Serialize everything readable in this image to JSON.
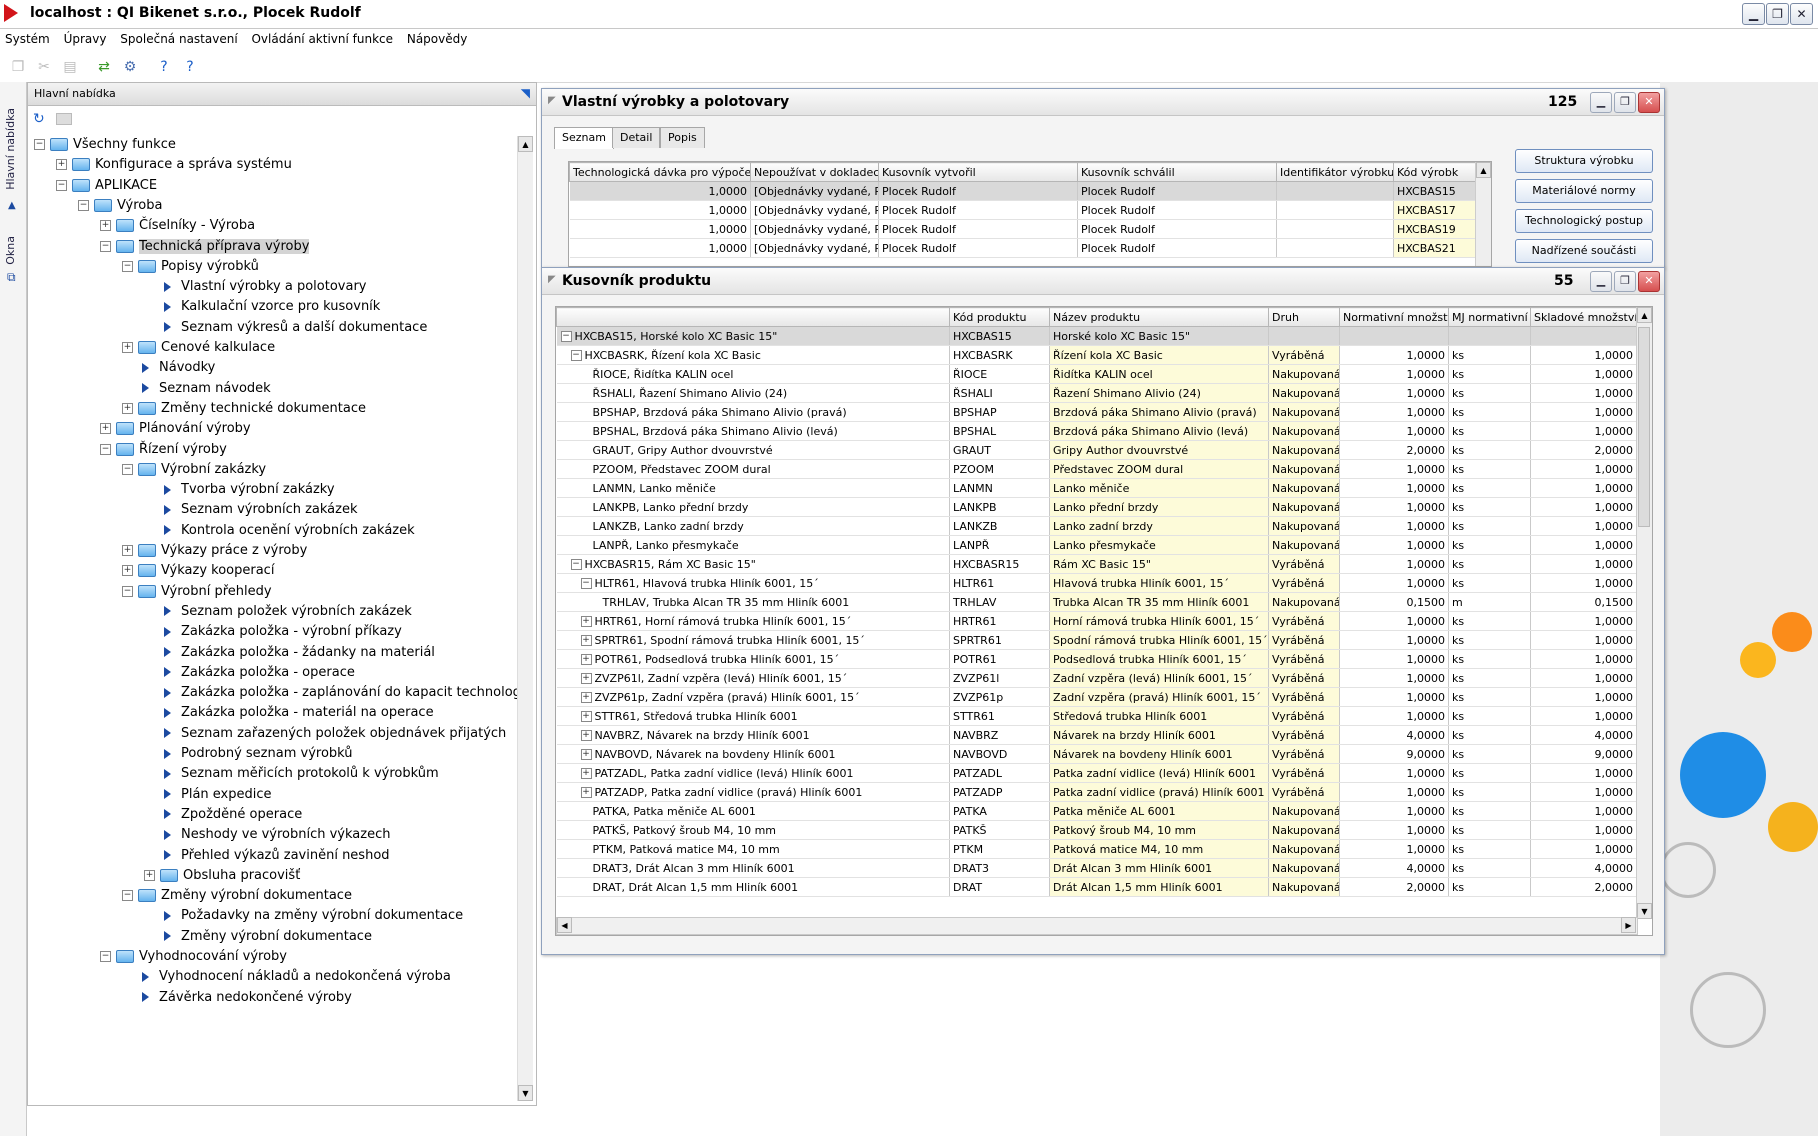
{
  "window": {
    "title": "localhost : QI  Bikenet s.r.o., Plocek Rudolf",
    "min": "▁",
    "max": "❐",
    "close": "✕"
  },
  "menu": [
    "Systém",
    "Úpravy",
    "Společná nastavení",
    "Ovládání aktivní funkce",
    "Nápovědy"
  ],
  "left_tabs": {
    "main": "Hlavní nabídka",
    "windows": "Okna"
  },
  "nav": {
    "header": "Hlavní nabídka",
    "tree": [
      {
        "d": 0,
        "t": "f",
        "e": "-",
        "label": "Všechny funkce"
      },
      {
        "d": 1,
        "t": "f",
        "e": "+",
        "label": "Konfigurace a správa systému"
      },
      {
        "d": 1,
        "t": "f",
        "e": "-",
        "label": "APLIKACE"
      },
      {
        "d": 2,
        "t": "f",
        "e": "-",
        "label": "Výroba"
      },
      {
        "d": 3,
        "t": "f",
        "e": "+",
        "label": "Číselníky - Výroba"
      },
      {
        "d": 3,
        "t": "f",
        "e": "-",
        "label": "Technická příprava výroby",
        "sel": true
      },
      {
        "d": 4,
        "t": "f",
        "e": "-",
        "label": "Popisy výrobků"
      },
      {
        "d": 5,
        "t": "l",
        "label": "Vlastní výrobky a polotovary"
      },
      {
        "d": 5,
        "t": "l",
        "label": "Kalkulační vzorce pro kusovník"
      },
      {
        "d": 5,
        "t": "l",
        "label": "Seznam výkresů a další dokumentace"
      },
      {
        "d": 4,
        "t": "f",
        "e": "+",
        "label": "Cenové kalkulace"
      },
      {
        "d": 4,
        "t": "l",
        "label": "Návodky"
      },
      {
        "d": 4,
        "t": "l",
        "label": "Seznam návodek"
      },
      {
        "d": 4,
        "t": "f",
        "e": "+",
        "label": "Změny technické dokumentace"
      },
      {
        "d": 3,
        "t": "f",
        "e": "+",
        "label": "Plánování výroby"
      },
      {
        "d": 3,
        "t": "f",
        "e": "-",
        "label": "Řízení výroby"
      },
      {
        "d": 4,
        "t": "f",
        "e": "-",
        "label": "Výrobní zakázky"
      },
      {
        "d": 5,
        "t": "l",
        "label": "Tvorba výrobní zakázky"
      },
      {
        "d": 5,
        "t": "l",
        "label": "Seznam výrobních zakázek"
      },
      {
        "d": 5,
        "t": "l",
        "label": "Kontrola ocenění výrobních zakázek"
      },
      {
        "d": 4,
        "t": "f",
        "e": "+",
        "label": "Výkazy práce z výroby"
      },
      {
        "d": 4,
        "t": "f",
        "e": "+",
        "label": "Výkazy kooperací"
      },
      {
        "d": 4,
        "t": "f",
        "e": "-",
        "label": "Výrobní přehledy"
      },
      {
        "d": 5,
        "t": "l",
        "label": "Seznam položek výrobních zakázek"
      },
      {
        "d": 5,
        "t": "l",
        "label": "Zakázka položka - výrobní příkazy"
      },
      {
        "d": 5,
        "t": "l",
        "label": "Zakázka položka - žádanky na materiál"
      },
      {
        "d": 5,
        "t": "l",
        "label": "Zakázka položka - operace"
      },
      {
        "d": 5,
        "t": "l",
        "label": "Zakázka položka - zaplánování do kapacit technologií"
      },
      {
        "d": 5,
        "t": "l",
        "label": "Zakázka položka - materiál na operace"
      },
      {
        "d": 5,
        "t": "l",
        "label": "Seznam zařazených položek objednávek přijatých"
      },
      {
        "d": 5,
        "t": "l",
        "label": "Podrobný seznam výrobků"
      },
      {
        "d": 5,
        "t": "l",
        "label": "Seznam měřicích protokolů k výrobkům"
      },
      {
        "d": 5,
        "t": "l",
        "label": "Plán expedice"
      },
      {
        "d": 5,
        "t": "l",
        "label": "Zpožděné operace"
      },
      {
        "d": 5,
        "t": "l",
        "label": "Neshody ve výrobních výkazech"
      },
      {
        "d": 5,
        "t": "l",
        "label": "Přehled výkazů zavinění neshod"
      },
      {
        "d": 5,
        "t": "f",
        "e": "+",
        "label": "Obsluha pracovišť"
      },
      {
        "d": 4,
        "t": "f",
        "e": "-",
        "label": "Změny výrobní dokumentace"
      },
      {
        "d": 5,
        "t": "l",
        "label": "Požadavky na změny výrobní dokumentace"
      },
      {
        "d": 5,
        "t": "l",
        "label": "Změny výrobní dokumentace"
      },
      {
        "d": 3,
        "t": "f",
        "e": "-",
        "label": "Vyhodnocování výroby"
      },
      {
        "d": 4,
        "t": "l",
        "label": "Vyhodnocení nákladů a nedokončená výroba"
      },
      {
        "d": 4,
        "t": "l",
        "label": "Závěrka nedokončené výroby"
      }
    ]
  },
  "win1": {
    "title": "Vlastní výrobky a polotovary",
    "count": "125",
    "tabs": [
      "Seznam",
      "Detail",
      "Popis"
    ],
    "columns": [
      "Technologická dávka pro výpočet",
      "Nepoužívat v dokladech",
      "Kusovník vytvořil",
      "Kusovník schválil",
      "Identifikátor výrobku",
      "Kód výrobk"
    ],
    "rows": [
      [
        "1,0000",
        "[Objednávky vydané, Př",
        "Plocek Rudolf",
        "Plocek Rudolf",
        "",
        "HXCBAS15"
      ],
      [
        "1,0000",
        "[Objednávky vydané, Př",
        "Plocek Rudolf",
        "Plocek Rudolf",
        "",
        "HXCBAS17"
      ],
      [
        "1,0000",
        "[Objednávky vydané, Př",
        "Plocek Rudolf",
        "Plocek Rudolf",
        "",
        "HXCBAS19"
      ],
      [
        "1,0000",
        "[Objednávky vydané, Př",
        "Plocek Rudolf",
        "Plocek Rudolf",
        "",
        "HXCBAS21"
      ]
    ],
    "buttons": [
      "Struktura výrobku",
      "Materiálové normy",
      "Technologický postup",
      "Nadřízené součásti"
    ]
  },
  "win2": {
    "title": "Kusovník produktu",
    "count": "55",
    "columns": [
      "",
      "Kód produktu",
      "Název produktu",
      "Druh",
      "Normativní množství",
      "MJ normativní",
      "Skladové množství"
    ],
    "rows": [
      {
        "i": 0,
        "e": "-",
        "t": "HXCBAS15, Horské kolo XC Basic 15\"",
        "k": "HXCBAS15",
        "n": "Horské kolo XC Basic 15\"",
        "d": "",
        "q": "",
        "m": "",
        "s": ""
      },
      {
        "i": 1,
        "e": "-",
        "t": "HXCBASRK, Řízení kola XC Basic",
        "k": "HXCBASRK",
        "n": "Řízení kola XC Basic",
        "d": "Vyráběná",
        "q": "1,0000",
        "m": "ks",
        "s": "1,0000"
      },
      {
        "i": 2,
        "e": "",
        "t": "ŘIOCE, Řidítka KALIN ocel",
        "k": "ŘIOCE",
        "n": "Řidítka KALIN ocel",
        "d": "Nakupovaná",
        "q": "1,0000",
        "m": "ks",
        "s": "1,0000"
      },
      {
        "i": 2,
        "e": "",
        "t": "ŘSHALI, Řazení Shimano Alivio (24)",
        "k": "ŘSHALI",
        "n": "Řazení Shimano Alivio (24)",
        "d": "Nakupovaná",
        "q": "1,0000",
        "m": "ks",
        "s": "1,0000"
      },
      {
        "i": 2,
        "e": "",
        "t": "BPSHAP, Brzdová páka Shimano Alivio (pravá)",
        "k": "BPSHAP",
        "n": "Brzdová páka Shimano Alivio (pravá)",
        "d": "Nakupovaná",
        "q": "1,0000",
        "m": "ks",
        "s": "1,0000"
      },
      {
        "i": 2,
        "e": "",
        "t": "BPSHAL, Brzdová páka Shimano Alivio (levá)",
        "k": "BPSHAL",
        "n": "Brzdová páka Shimano Alivio (levá)",
        "d": "Nakupovaná",
        "q": "1,0000",
        "m": "ks",
        "s": "1,0000"
      },
      {
        "i": 2,
        "e": "",
        "t": "GRAUT, Gripy Author dvouvrstvé",
        "k": "GRAUT",
        "n": "Gripy Author dvouvrstvé",
        "d": "Nakupovaná",
        "q": "2,0000",
        "m": "ks",
        "s": "2,0000"
      },
      {
        "i": 2,
        "e": "",
        "t": "PZOOM, Představec ZOOM dural",
        "k": "PZOOM",
        "n": "Představec ZOOM dural",
        "d": "Nakupovaná",
        "q": "1,0000",
        "m": "ks",
        "s": "1,0000"
      },
      {
        "i": 2,
        "e": "",
        "t": "LANMN, Lanko měniče",
        "k": "LANMN",
        "n": "Lanko měniče",
        "d": "Nakupovaná",
        "q": "1,0000",
        "m": "ks",
        "s": "1,0000"
      },
      {
        "i": 2,
        "e": "",
        "t": "LANKPB, Lanko přední brzdy",
        "k": "LANKPB",
        "n": "Lanko přední brzdy",
        "d": "Nakupovaná",
        "q": "1,0000",
        "m": "ks",
        "s": "1,0000"
      },
      {
        "i": 2,
        "e": "",
        "t": "LANKZB, Lanko zadní brzdy",
        "k": "LANKZB",
        "n": "Lanko zadní brzdy",
        "d": "Nakupovaná",
        "q": "1,0000",
        "m": "ks",
        "s": "1,0000"
      },
      {
        "i": 2,
        "e": "",
        "t": "LANPŘ, Lanko přesmykače",
        "k": "LANPŘ",
        "n": "Lanko přesmykače",
        "d": "Nakupovaná",
        "q": "1,0000",
        "m": "ks",
        "s": "1,0000"
      },
      {
        "i": 1,
        "e": "-",
        "t": "HXCBASR15, Rám XC Basic 15\"",
        "k": "HXCBASR15",
        "n": "Rám XC Basic 15\"",
        "d": "Vyráběná",
        "q": "1,0000",
        "m": "ks",
        "s": "1,0000"
      },
      {
        "i": 2,
        "e": "-",
        "t": "HLTR61, Hlavová trubka Hliník 6001, 15´",
        "k": "HLTR61",
        "n": "Hlavová trubka Hliník 6001, 15´",
        "d": "Vyráběná",
        "q": "1,0000",
        "m": "ks",
        "s": "1,0000"
      },
      {
        "i": 3,
        "e": "",
        "t": "TRHLAV, Trubka Alcan TR 35 mm Hliník 6001",
        "k": "TRHLAV",
        "n": "Trubka Alcan TR 35 mm Hliník 6001",
        "d": "Nakupovaná",
        "q": "0,1500",
        "m": "m",
        "s": "0,1500"
      },
      {
        "i": 2,
        "e": "+",
        "t": "HRTR61, Horní rámová trubka Hliník 6001, 15´",
        "k": "HRTR61",
        "n": "Horní rámová trubka Hliník 6001, 15´",
        "d": "Vyráběná",
        "q": "1,0000",
        "m": "ks",
        "s": "1,0000"
      },
      {
        "i": 2,
        "e": "+",
        "t": "SPRTR61, Spodní rámová trubka Hliník 6001, 15´",
        "k": "SPRTR61",
        "n": "Spodní rámová trubka Hliník 6001, 15´",
        "d": "Vyráběná",
        "q": "1,0000",
        "m": "ks",
        "s": "1,0000"
      },
      {
        "i": 2,
        "e": "+",
        "t": "POTR61, Podsedlová trubka Hliník 6001, 15´",
        "k": "POTR61",
        "n": "Podsedlová trubka Hliník 6001, 15´",
        "d": "Vyráběná",
        "q": "1,0000",
        "m": "ks",
        "s": "1,0000"
      },
      {
        "i": 2,
        "e": "+",
        "t": "ZVZP61l, Zadní vzpěra (levá) Hliník 6001, 15´",
        "k": "ZVZP61l",
        "n": "Zadní vzpěra (levá) Hliník 6001, 15´",
        "d": "Vyráběná",
        "q": "1,0000",
        "m": "ks",
        "s": "1,0000"
      },
      {
        "i": 2,
        "e": "+",
        "t": "ZVZP61p, Zadní vzpěra (pravá) Hliník 6001, 15´",
        "k": "ZVZP61p",
        "n": "Zadní vzpěra (pravá) Hliník 6001, 15´",
        "d": "Vyráběná",
        "q": "1,0000",
        "m": "ks",
        "s": "1,0000"
      },
      {
        "i": 2,
        "e": "+",
        "t": "STTR61, Středová trubka Hliník 6001",
        "k": "STTR61",
        "n": "Středová trubka Hliník 6001",
        "d": "Vyráběná",
        "q": "1,0000",
        "m": "ks",
        "s": "1,0000"
      },
      {
        "i": 2,
        "e": "+",
        "t": "NAVBRZ, Návarek na brzdy Hliník 6001",
        "k": "NAVBRZ",
        "n": "Návarek na brzdy Hliník 6001",
        "d": "Vyráběná",
        "q": "4,0000",
        "m": "ks",
        "s": "4,0000"
      },
      {
        "i": 2,
        "e": "+",
        "t": "NAVBOVD, Návarek na bovdeny Hliník 6001",
        "k": "NAVBOVD",
        "n": "Návarek na bovdeny Hliník 6001",
        "d": "Vyráběná",
        "q": "9,0000",
        "m": "ks",
        "s": "9,0000"
      },
      {
        "i": 2,
        "e": "+",
        "t": "PATZADL, Patka zadní vidlice (levá) Hliník 6001",
        "k": "PATZADL",
        "n": "Patka zadní vidlice (levá) Hliník 6001",
        "d": "Vyráběná",
        "q": "1,0000",
        "m": "ks",
        "s": "1,0000"
      },
      {
        "i": 2,
        "e": "+",
        "t": "PATZADP, Patka zadní vidlice (pravá) Hliník 6001",
        "k": "PATZADP",
        "n": "Patka zadní vidlice (pravá) Hliník 6001",
        "d": "Vyráběná",
        "q": "1,0000",
        "m": "ks",
        "s": "1,0000"
      },
      {
        "i": 2,
        "e": "",
        "t": "PATKA, Patka měniče AL 6001",
        "k": "PATKA",
        "n": "Patka měniče AL 6001",
        "d": "Nakupovaná",
        "q": "1,0000",
        "m": "ks",
        "s": "1,0000"
      },
      {
        "i": 2,
        "e": "",
        "t": "PATKŠ, Patkový šroub M4, 10 mm",
        "k": "PATKŠ",
        "n": "Patkový šroub M4, 10 mm",
        "d": "Nakupovaná",
        "q": "1,0000",
        "m": "ks",
        "s": "1,0000"
      },
      {
        "i": 2,
        "e": "",
        "t": "PTKM, Patková matice M4, 10 mm",
        "k": "PTKM",
        "n": "Patková matice M4, 10 mm",
        "d": "Nakupovaná",
        "q": "1,0000",
        "m": "ks",
        "s": "1,0000"
      },
      {
        "i": 2,
        "e": "",
        "t": "DRAT3, Drát Alcan 3 mm Hliník 6001",
        "k": "DRAT3",
        "n": "Drát Alcan 3 mm Hliník 6001",
        "d": "Nakupovaná",
        "q": "4,0000",
        "m": "ks",
        "s": "4,0000"
      },
      {
        "i": 2,
        "e": "",
        "t": "DRAT, Drát Alcan 1,5 mm Hliník 6001",
        "k": "DRAT",
        "n": "Drát Alcan 1,5 mm Hliník 6001",
        "d": "Nakupovaná",
        "q": "2,0000",
        "m": "ks",
        "s": "2,0000"
      }
    ]
  }
}
